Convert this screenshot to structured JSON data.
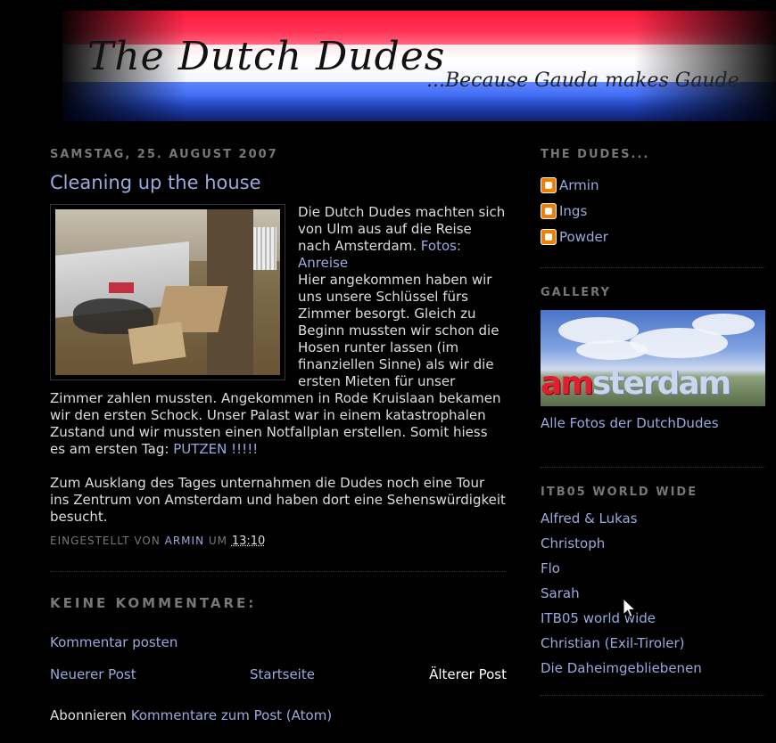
{
  "header": {
    "title": "The Dutch Dudes",
    "tagline": "...Because Gauda makes Gaude"
  },
  "post": {
    "date": "SAMSTAG, 25. AUGUST 2007",
    "title": "Cleaning up the house",
    "body": {
      "p1_a": "Die Dutch Dudes machten sich von Ulm aus auf die Reise nach Amsterdam.",
      "p1_link": "Fotos: Anreise",
      "p1_b": "Hier angekommen haben wir uns unsere Schlüssel fürs Zimmer besorgt. Gleich zu Beginn mussten wir schon die Hosen runter lassen (im finanziellen Sinne) als wir die ersten Mieten für unser Zimmer zahlen mussten. Angekommen in Rode Kruislaan bekamen wir den ersten Schock. Unser Palast war in einem katastrophalen Zustand und wir mussten einen Notfallplan erstellen. Somit hiess es am ersten Tag:",
      "p1_link2": "PUTZEN !!!!!",
      "p2": "Zum Ausklang des Tages unternahmen die Dudes noch eine Tour ins Zentrum von Amsterdam und haben dort eine Sehenswürdigkeit besucht."
    },
    "footer": {
      "posted_by": "EINGESTELLT VON",
      "author": "ARMIN",
      "at": "UM",
      "time": "13:10"
    }
  },
  "comments": {
    "header": "KEINE KOMMENTARE:",
    "post_comment": "Kommentar posten"
  },
  "pager": {
    "newer": "Neuerer Post",
    "home": "Startseite",
    "older": "Älterer Post"
  },
  "subscribe": {
    "label": "Abonnieren",
    "link": "Kommentare zum Post (Atom)"
  },
  "sidebar": {
    "dudes": {
      "title": "THE DUDES...",
      "items": [
        "Armin",
        "Ings",
        "Powder"
      ]
    },
    "gallery": {
      "title": "GALLERY",
      "image_text_a": "am",
      "image_text_b": "sterdam",
      "caption": "Alle Fotos der DutchDudes"
    },
    "itb": {
      "title": "ITB05 WORLD WIDE",
      "items": [
        "Alfred & Lukas",
        "Christoph",
        "Flo",
        "Sarah",
        "ITB05 world wide",
        "Christian (Exil-Tiroler)",
        "Die Daheimgebliebenen"
      ]
    }
  },
  "colors": {
    "link": "#99aadd",
    "background": "#000000",
    "text": "#cccccc",
    "muted": "#777777",
    "blogger": "#f57d00"
  }
}
